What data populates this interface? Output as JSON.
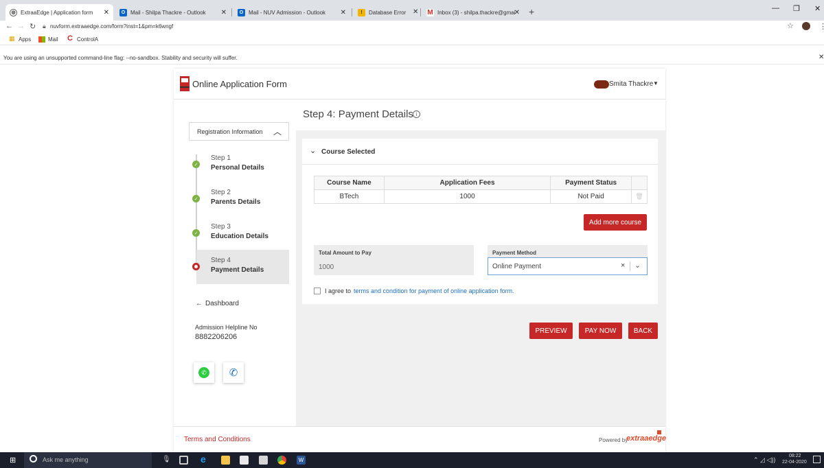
{
  "browser": {
    "tabs": [
      {
        "label": "ExtraaEdge | Application form",
        "icon": "globe-icon",
        "active": true
      },
      {
        "label": "Mail - Shilpa Thackre - Outlook",
        "icon": "outlook-icon"
      },
      {
        "label": "Mail - NUV Admission - Outlook",
        "icon": "outlook-icon"
      },
      {
        "label": "Database Error",
        "icon": "warning-icon"
      },
      {
        "label": "Inbox (3) - shilpa.thackre@gmai",
        "icon": "gmail-icon"
      }
    ],
    "url": "nuvform.extraaedge.com/form?inst=1&pm=k6wngf",
    "bookmarks": [
      "Apps",
      "Mail",
      "ControlA"
    ],
    "infobar": "You are using an unsupported command-line flag: --no-sandbox. Stability and security will suffer."
  },
  "app": {
    "title": "Online Application Form",
    "user_name": "Smita Thackre",
    "sidebar": {
      "section_title": "Registration Information",
      "steps": [
        {
          "num": "Step 1",
          "name": "Personal Details",
          "status": "done"
        },
        {
          "num": "Step 2",
          "name": "Parents Details",
          "status": "done"
        },
        {
          "num": "Step 3",
          "name": "Education Details",
          "status": "done"
        },
        {
          "num": "Step 4",
          "name": "Payment Details",
          "status": "current"
        }
      ],
      "dashboard": "Dashboard",
      "helpline_label": "Admission Helpline No",
      "helpline_number": "8882206206"
    },
    "main": {
      "step_title": "Step 4: Payment Details",
      "panel_title": "Course Selected",
      "table": {
        "headers": [
          "Course Name",
          "Application Fees",
          "Payment Status"
        ],
        "rows": [
          [
            "BTech",
            "1000",
            "Not Paid"
          ]
        ]
      },
      "add_more": "Add more course",
      "total_label": "Total Amount to Pay",
      "total_value": "1000",
      "method_label": "Payment Method",
      "method_value": "Online Payment",
      "agree_prefix": "I agree to",
      "agree_link": "terms and condition for payment of online application form.",
      "preview": "PREVIEW",
      "paynow": "PAY NOW",
      "back": "BACK"
    },
    "footer": {
      "terms": "Terms and Conditions",
      "powered": "Powered by",
      "brand": "extraaedge"
    }
  },
  "taskbar": {
    "search_placeholder": "Ask me anything",
    "time": "08:22",
    "date": "22-04-2020"
  },
  "colors": {
    "accent_red": "#c62828",
    "step_done": "#7cb342",
    "link_blue": "#1e6fc0"
  }
}
